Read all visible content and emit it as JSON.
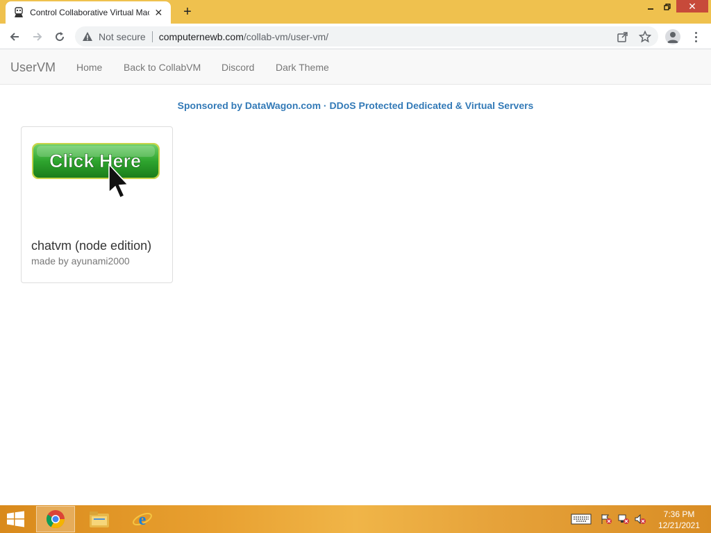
{
  "browser": {
    "tab_title": "Control Collaborative Virtual Mac",
    "security_label": "Not secure",
    "url_host": "computernewb.com",
    "url_path": "/collab-vm/user-vm/"
  },
  "site": {
    "brand": "UserVM",
    "nav": [
      "Home",
      "Back to CollabVM",
      "Discord",
      "Dark Theme"
    ],
    "sponsor": {
      "prefix": "Sponsored by ",
      "link1": "DataWagon.com",
      "separator": " · ",
      "link2": "DDoS Protected Dedicated & Virtual Servers"
    },
    "vms": [
      {
        "thumbnail_text": "Click Here",
        "title": "chatvm (node edition)",
        "author": "made by ayunami2000"
      }
    ]
  },
  "taskbar": {
    "apps": [
      "chrome-icon",
      "file-explorer-icon",
      "internet-explorer-icon"
    ],
    "time": "7:36 PM",
    "date": "12/21/2021"
  },
  "colors": {
    "tabstrip": "#efc14e",
    "link": "#337ab7",
    "navbar_bg": "#f8f8f8",
    "close_button": "#c74a3a",
    "button_green": "#2fa52f"
  }
}
